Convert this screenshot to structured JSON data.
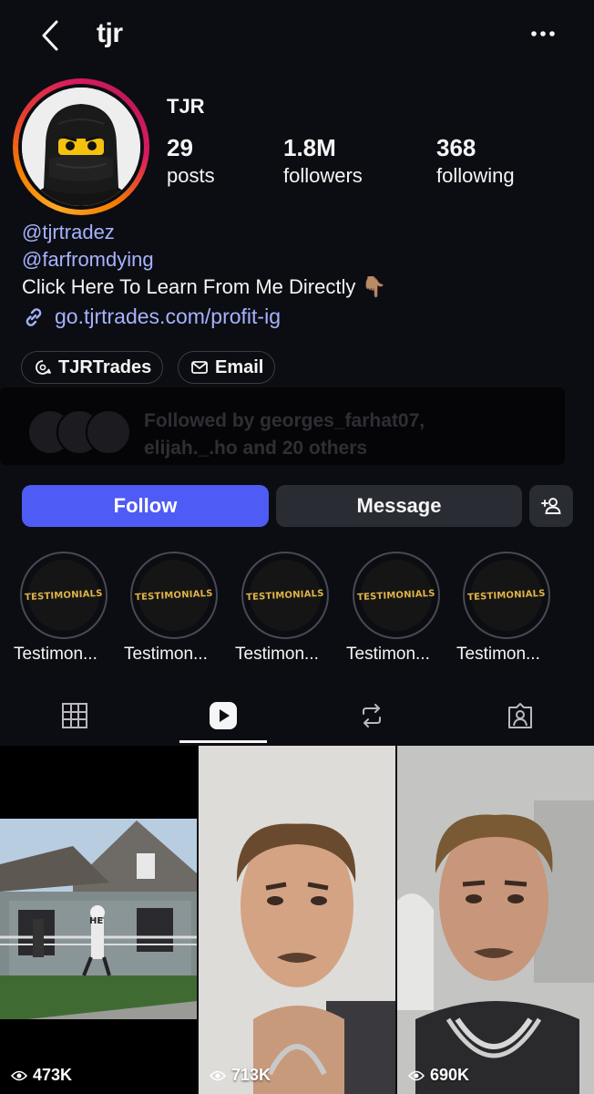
{
  "header": {
    "username": "tjr"
  },
  "profile": {
    "display_name": "TJR",
    "stats": [
      {
        "value": "29",
        "label": "posts"
      },
      {
        "value": "1.8M",
        "label": "followers"
      },
      {
        "value": "368",
        "label": "following"
      }
    ],
    "bio": {
      "mentions": [
        "@tjrtradez",
        "@farfromdying"
      ],
      "text": "Click Here To Learn From Me Directly",
      "emoji": "👇🏽",
      "link": "go.tjrtrades.com/profit-ig"
    },
    "chips": [
      {
        "label": "TJRTrades",
        "icon": "threads-icon"
      },
      {
        "label": "Email",
        "icon": "mail-icon"
      }
    ],
    "followed_by": "Followed by georges_farhat07, elijah._.ho and 20 others"
  },
  "actions": {
    "follow": "Follow",
    "message": "Message"
  },
  "highlights": {
    "cover_text": "TESTIMONIALS",
    "items": [
      {
        "label": "Testimon..."
      },
      {
        "label": "Testimon..."
      },
      {
        "label": "Testimon..."
      },
      {
        "label": "Testimon..."
      },
      {
        "label": "Testimon..."
      }
    ]
  },
  "tabs": [
    "grid-icon",
    "reels-icon",
    "repost-icon",
    "tagged-icon"
  ],
  "reels": [
    {
      "views": "473K",
      "overlay": "HE"
    },
    {
      "views": "713K"
    },
    {
      "views": "690K"
    }
  ],
  "colors": {
    "accent": "#4f5bf5",
    "link": "#a6b2ff",
    "background": "#0c0d12",
    "secondary_button": "#2a2c33"
  }
}
